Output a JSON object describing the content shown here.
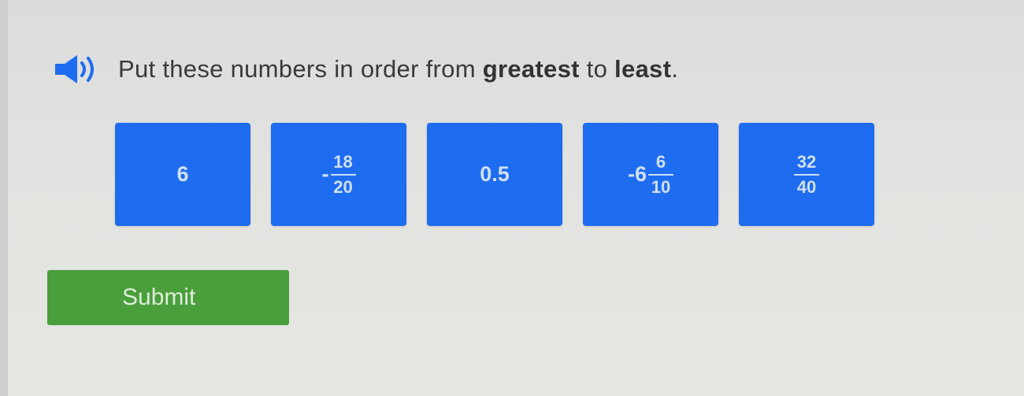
{
  "question": {
    "prefix": "Put these numbers in order from ",
    "emphasis1": "greatest",
    "middle": " to ",
    "emphasis2": "least",
    "suffix": "."
  },
  "tiles": [
    {
      "text": "6"
    },
    {
      "sign": "-",
      "numerator": "18",
      "denominator": "20"
    },
    {
      "text": "0.5"
    },
    {
      "whole": "-6",
      "numerator": "6",
      "denominator": "10"
    },
    {
      "numerator": "32",
      "denominator": "40"
    }
  ],
  "submit_label": "Submit",
  "colors": {
    "tile": "#1e6cf0",
    "submit": "#4a9e3c",
    "speaker": "#1e6cf0"
  },
  "icons": {
    "speaker": "speaker-icon"
  }
}
